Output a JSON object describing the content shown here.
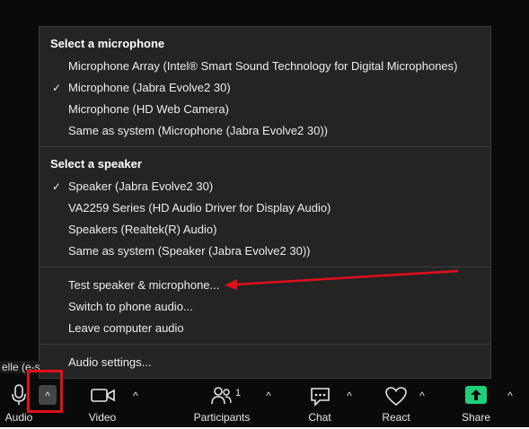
{
  "menu": {
    "microphone_heading": "Select a microphone",
    "microphones": [
      {
        "label": "Microphone Array (Intel® Smart Sound Technology for Digital Microphones)",
        "checked": false
      },
      {
        "label": "Microphone (Jabra Evolve2 30)",
        "checked": true
      },
      {
        "label": "Microphone (HD Web Camera)",
        "checked": false
      },
      {
        "label": "Same as system (Microphone (Jabra Evolve2 30))",
        "checked": false
      }
    ],
    "speaker_heading": "Select a speaker",
    "speakers": [
      {
        "label": "Speaker (Jabra Evolve2 30)",
        "checked": true
      },
      {
        "label": "VA2259 Series (HD Audio Driver for Display Audio)",
        "checked": false
      },
      {
        "label": "Speakers (Realtek(R) Audio)",
        "checked": false
      },
      {
        "label": "Same as system (Speaker (Jabra Evolve2 30))",
        "checked": false
      }
    ],
    "actions": [
      "Test speaker & microphone...",
      "Switch to phone audio...",
      "Leave computer audio"
    ],
    "settings": "Audio settings...",
    "check_glyph": "✓"
  },
  "side_label": "elle (e-s",
  "toolbar": {
    "audio": "Audio",
    "video": "Video",
    "participants": "Participants",
    "participants_count": "1",
    "chat": "Chat",
    "react": "React",
    "share": "Share",
    "chevron_glyph": "^"
  },
  "colors": {
    "annotation": "#e0101a",
    "share_green": "#1fd07a",
    "menu_bg": "#242424"
  },
  "icons": [
    "microphone-icon",
    "video-camera-icon",
    "participants-icon",
    "chat-icon",
    "heart-icon",
    "share-arrow-icon",
    "checkmark-icon",
    "chevron-up-icon"
  ]
}
